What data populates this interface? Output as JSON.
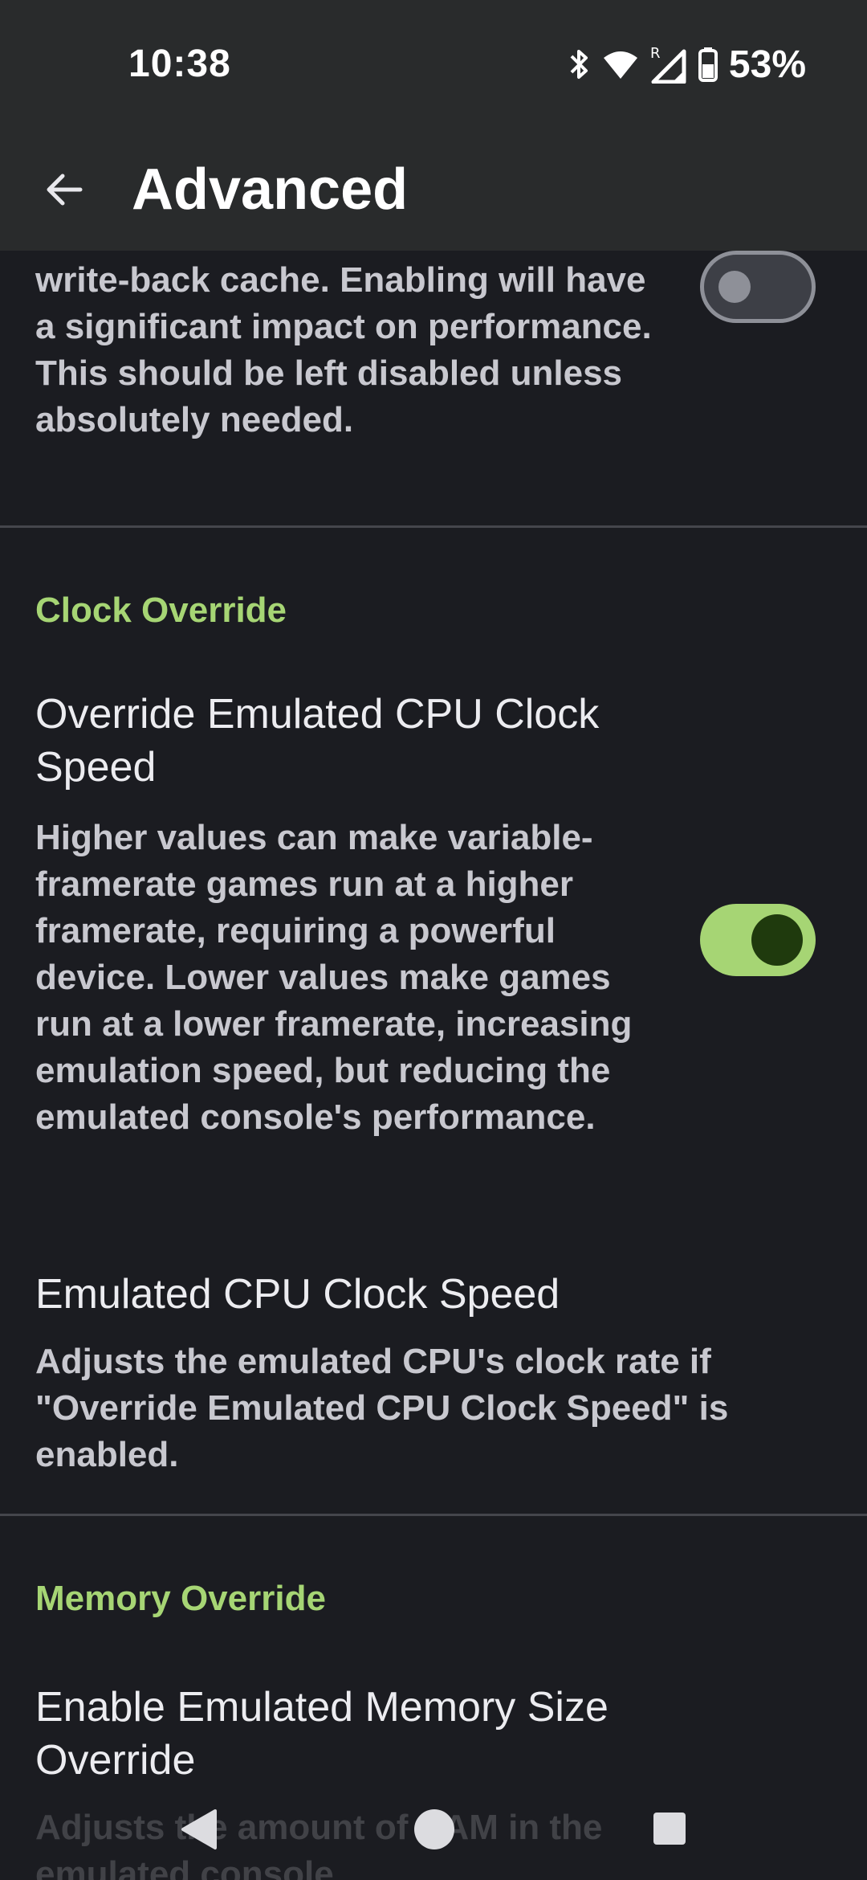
{
  "status_bar": {
    "time": "10:38",
    "battery_percent": "53%",
    "icons": [
      "bluetooth-icon",
      "wifi-icon",
      "signal-roaming-icon",
      "battery-icon"
    ]
  },
  "app_bar": {
    "title": "Advanced",
    "back_icon": "arrow-back-icon"
  },
  "items": {
    "cache_item": {
      "description": "write-back cache. Enabling will have a significant impact on performance. This should be left disabled unless absolutely needed.",
      "toggle_on": false
    },
    "clock_override_header": "Clock Override",
    "override_cpu": {
      "title": "Override Emulated CPU Clock Speed",
      "description": "Higher values can make variable-framerate games run at a higher framerate, requiring a powerful device. Lower values make games run at a lower framerate, increasing emulation speed, but reducing the emulated console's performance.",
      "toggle_on": true
    },
    "cpu_speed": {
      "title": "Emulated CPU Clock Speed",
      "description": "Adjusts the emulated CPU's clock rate if \"Override Emulated CPU Clock Speed\" is enabled."
    },
    "memory_override_header": "Memory Override",
    "memory_override": {
      "title": "Enable Emulated Memory Size Override",
      "description": "Adjusts the amount of RAM in the emulated console."
    }
  },
  "colors": {
    "accent": "#a6d574",
    "background": "#1b1c21",
    "bar": "#292b2c"
  },
  "nav_bar": [
    "back-triangle-icon",
    "home-circle-icon",
    "recents-square-icon"
  ]
}
